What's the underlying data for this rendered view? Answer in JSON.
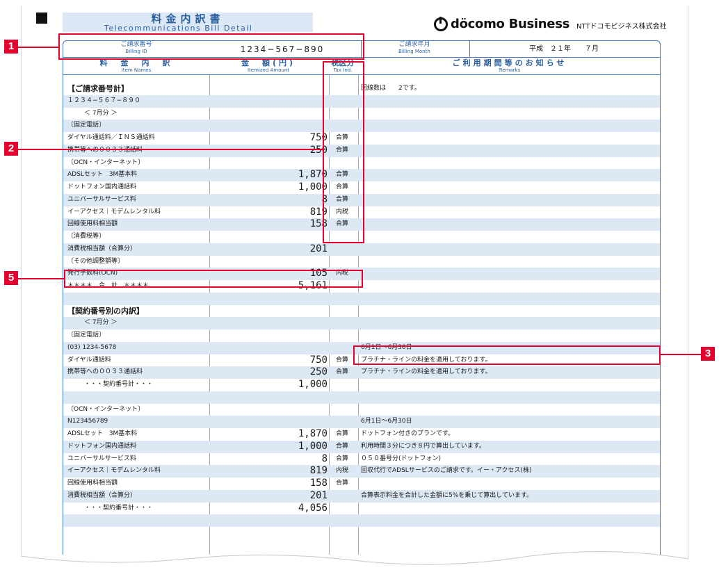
{
  "header": {
    "title_jp": "料金内訳書",
    "title_en": "Telecommunications Bill Detail",
    "logo_text": "döcomo Business",
    "company": "NTTドコモビジネス株式会社"
  },
  "billing": {
    "id_label_jp": "ご請求番号",
    "id_label_en": "Billing ID",
    "id_value": "1234−567−890",
    "month_label_jp": "ご請求年月",
    "month_label_en": "Billing Month",
    "month_value": "平成　２１年　　７月"
  },
  "columns": {
    "names_jp": "料　金　内　訳",
    "names_en": "Item Names",
    "amount_jp": "金　額(円)",
    "amount_en": "Itemized Amount",
    "tax_jp": "税区分",
    "tax_en": "Tax Ind.",
    "remarks_jp": "ご利用期間等のお知らせ",
    "remarks_en": "Remarks"
  },
  "rows": [
    {
      "name": "【ご請求番号計】",
      "amount": "",
      "tax": "",
      "remark": "回線数は　　2です。",
      "bold": true
    },
    {
      "name": "１２３４−５６７−８９０",
      "amount": "",
      "tax": "",
      "remark": ""
    },
    {
      "name": "＜ 7月分 ＞",
      "amount": "",
      "tax": "",
      "remark": "",
      "indent": true
    },
    {
      "name": "〔固定電話〕",
      "amount": "",
      "tax": "",
      "remark": ""
    },
    {
      "name": "ダイヤル通話料／ＩＮＳ通話料",
      "amount": "750",
      "tax": "合算",
      "remark": ""
    },
    {
      "name": "携帯等への００３３通話料",
      "amount": "250",
      "tax": "合算",
      "remark": ""
    },
    {
      "name": "〔OCN・インターネット〕",
      "amount": "",
      "tax": "",
      "remark": ""
    },
    {
      "name": "ADSLセット　3M基本料",
      "amount": "1,870",
      "tax": "合算",
      "remark": ""
    },
    {
      "name": "ドットフォン国内通話料",
      "amount": "1,000",
      "tax": "合算",
      "remark": ""
    },
    {
      "name": "ユニバーサルサービス料",
      "amount": "8",
      "tax": "合算",
      "remark": ""
    },
    {
      "name": "イーアクセス｜モデムレンタル料",
      "amount": "819",
      "tax": "内税",
      "remark": ""
    },
    {
      "name": "回線使用料相当額",
      "amount": "158",
      "tax": "合算",
      "remark": ""
    },
    {
      "name": "〔消費税等〕",
      "amount": "",
      "tax": "",
      "remark": ""
    },
    {
      "name": "消費税相当額（合算分）",
      "amount": "201",
      "tax": "",
      "remark": ""
    },
    {
      "name": "〔その他調整額等〕",
      "amount": "",
      "tax": "",
      "remark": ""
    },
    {
      "name": "発行手数料(OCN)",
      "amount": "105",
      "tax": "内税",
      "remark": ""
    },
    {
      "name": "＊＊＊＊　合　計　＊＊＊＊",
      "amount": "5,161",
      "tax": "",
      "remark": ""
    },
    {
      "name": "",
      "amount": "",
      "tax": "",
      "remark": ""
    },
    {
      "name": "【契約番号別の内訳】",
      "amount": "",
      "tax": "",
      "remark": "",
      "bold": true
    },
    {
      "name": "＜ 7月分 ＞",
      "amount": "",
      "tax": "",
      "remark": "",
      "indent": true
    },
    {
      "name": "〔固定電話〕",
      "amount": "",
      "tax": "",
      "remark": ""
    },
    {
      "name": "(03) 1234-5678",
      "amount": "",
      "tax": "",
      "remark": "6月1日〜6月30日"
    },
    {
      "name": "ダイヤル通話料",
      "amount": "750",
      "tax": "合算",
      "remark": "プラチナ・ラインの料金を適用しております。"
    },
    {
      "name": "携帯等への００３３通話料",
      "amount": "250",
      "tax": "合算",
      "remark": "プラチナ・ラインの料金を適用しております。"
    },
    {
      "name": "・・・契約番号計・・・",
      "amount": "1,000",
      "tax": "",
      "remark": "",
      "indent": true
    },
    {
      "name": "",
      "amount": "",
      "tax": "",
      "remark": ""
    },
    {
      "name": "〔OCN・インターネット〕",
      "amount": "",
      "tax": "",
      "remark": ""
    },
    {
      "name": "N123456789",
      "amount": "",
      "tax": "",
      "remark": "6月1日〜6月30日"
    },
    {
      "name": "ADSLセット　3M基本料",
      "amount": "1,870",
      "tax": "合算",
      "remark": "ドットフォン付きのプランです。"
    },
    {
      "name": "ドットフォン国内通話料",
      "amount": "1,000",
      "tax": "合算",
      "remark": "利用時間３分につき８円で算出しています。"
    },
    {
      "name": "ユニバーサルサービス料",
      "amount": "8",
      "tax": "合算",
      "remark": "０５０番号分(ドットフォン)"
    },
    {
      "name": "イーアクセス｜モデムレンタル料",
      "amount": "819",
      "tax": "内税",
      "remark": "回収代行でADSLサービスのご請求です。イー・アクセス(株)"
    },
    {
      "name": "回線使用料相当額",
      "amount": "158",
      "tax": "合算",
      "remark": ""
    },
    {
      "name": "消費税相当額（合算分）",
      "amount": "201",
      "tax": "",
      "remark": "合算表示料金を合計した金額に5%を乗じて算出しています。"
    },
    {
      "name": "・・・契約番号計・・・",
      "amount": "4,056",
      "tax": "",
      "remark": "",
      "indent": true
    },
    {
      "name": "",
      "amount": "",
      "tax": "",
      "remark": ""
    },
    {
      "name": "",
      "amount": "",
      "tax": "",
      "remark": ""
    }
  ],
  "callouts": {
    "c1": "1",
    "c2": "2",
    "c3": "3",
    "c5": "5"
  },
  "colors": {
    "accent": "#3f7ac0",
    "band": "#dde8f5",
    "callout": "#e6002d"
  }
}
